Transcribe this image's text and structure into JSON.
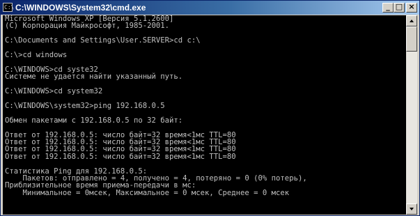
{
  "window": {
    "title": "C:\\WINDOWS\\System32\\cmd.exe",
    "icon_label": "C:\\",
    "buttons": {
      "minimize": "_",
      "maximize": "□",
      "close": "×"
    }
  },
  "console": {
    "lines": [
      "Microsoft Windows XP [Версия 5.1.2600]",
      "(С) Корпорация Майкрософт, 1985-2001.",
      "",
      "C:\\Documents and Settings\\User.SERVER>cd c:\\",
      "",
      "C:\\>cd windows",
      "",
      "C:\\WINDOWS>cd syste32",
      "Системе не удается найти указанный путь.",
      "",
      "C:\\WINDOWS>cd system32",
      "",
      "C:\\WINDOWS\\system32>ping 192.168.0.5",
      "",
      "Обмен пакетами с 192.168.0.5 по 32 байт:",
      "",
      "Ответ от 192.168.0.5: число байт=32 время<1мс TTL=80",
      "Ответ от 192.168.0.5: число байт=32 время<1мс TTL=80",
      "Ответ от 192.168.0.5: число байт=32 время<1мс TTL=80",
      "Ответ от 192.168.0.5: число байт=32 время<1мс TTL=80",
      "",
      "Статистика Ping для 192.168.0.5:",
      "    Пакетов: отправлено = 4, получено = 4, потеряно = 0 (0% потерь),",
      "Приблизительное время приема-передачи в мс:",
      "    Минимальное = 0мсек, Максимальное = 0 мсек, Среднее = 0 мсек"
    ]
  },
  "colors": {
    "console_bg": "#000000",
    "console_fg": "#c0c0c0",
    "titlebar_start": "#0a246a",
    "titlebar_end": "#a6caf0"
  },
  "icons": [
    "cmd-app-icon",
    "minimize-icon",
    "maximize-icon",
    "close-icon",
    "scroll-up-arrow-icon",
    "scroll-down-arrow-icon"
  ]
}
